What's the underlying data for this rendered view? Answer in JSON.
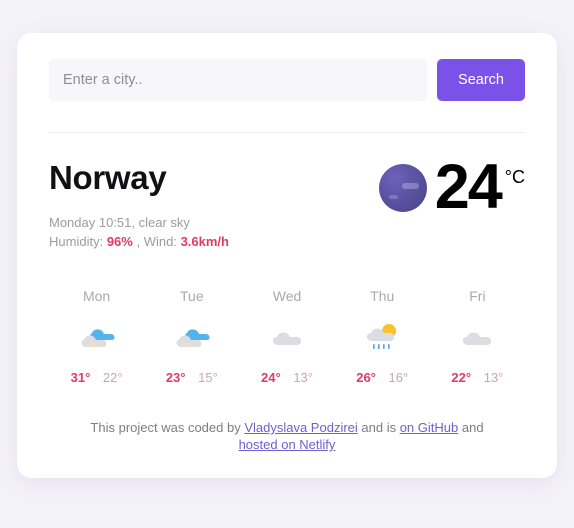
{
  "search": {
    "placeholder": "Enter a city..",
    "value": "",
    "button_label": "Search"
  },
  "current": {
    "city": "Norway",
    "datetime_description": "Monday 10:51, clear sky",
    "humidity_label": "Humidity:",
    "humidity_value": "96%",
    "wind_label": ", Wind:",
    "wind_value": "3.6km/h",
    "temperature": "24",
    "unit": "°C",
    "icon": "moon-clear-icon"
  },
  "forecast": [
    {
      "day": "Mon",
      "icon": "cloud-behind-cloud-icon",
      "max": "31°",
      "min": "22°"
    },
    {
      "day": "Tue",
      "icon": "cloud-behind-cloud-icon",
      "max": "23°",
      "min": "15°"
    },
    {
      "day": "Wed",
      "icon": "cloud-icon",
      "max": "24°",
      "min": "13°"
    },
    {
      "day": "Thu",
      "icon": "sun-behind-rain-cloud-icon",
      "max": "26°",
      "min": "16°"
    },
    {
      "day": "Fri",
      "icon": "cloud-icon",
      "max": "22°",
      "min": "13°"
    }
  ],
  "footer": {
    "prefix": "This project was coded by ",
    "author": "Vladyslava Podzirei",
    "middle": " and is ",
    "github": "on GitHub",
    "conjunction": " and ",
    "host": "hosted on Netlify"
  },
  "colors": {
    "accent": "#7b52e8",
    "highlight": "#e13a63",
    "page_background": "#f4f2f9",
    "card_background": "#ffffff",
    "link": "#6f5fd0"
  }
}
